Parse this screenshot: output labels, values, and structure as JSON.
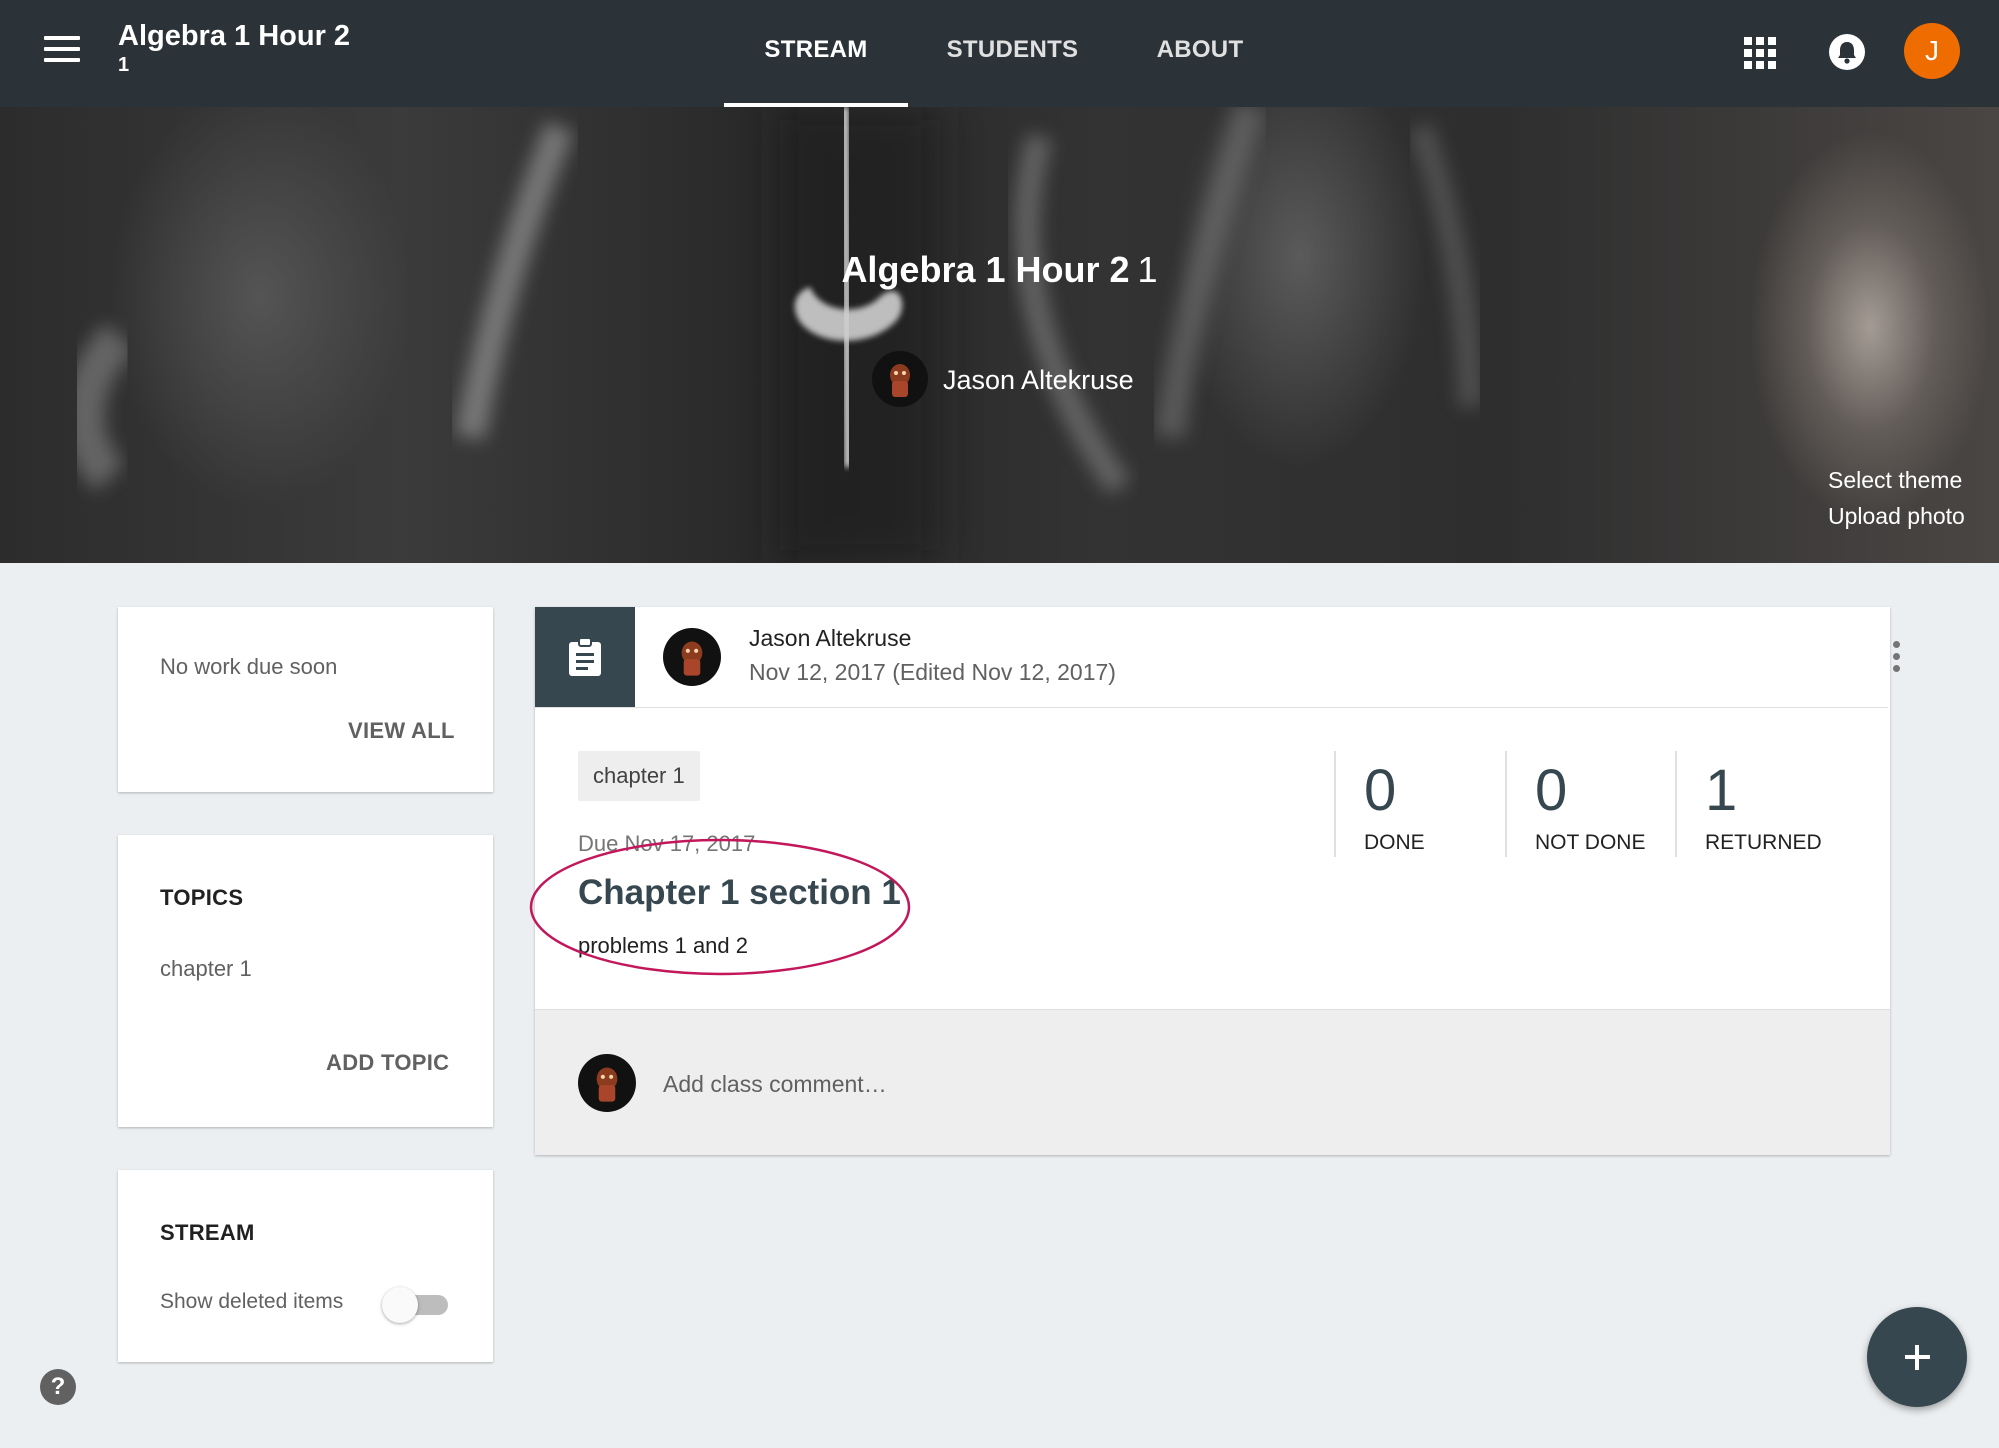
{
  "header": {
    "class_title": "Algebra 1 Hour 2",
    "class_section": "1",
    "tabs": [
      {
        "label": "STREAM",
        "active": true
      },
      {
        "label": "STUDENTS",
        "active": false
      },
      {
        "label": "ABOUT",
        "active": false
      }
    ],
    "user_initial": "J",
    "accent_color": "#ef6c00"
  },
  "banner": {
    "title": "Algebra 1 Hour 2",
    "section": "1",
    "teacher_name": "Jason Altekruse",
    "select_theme": "Select theme",
    "upload_photo": "Upload photo"
  },
  "upcoming": {
    "text": "No work due soon",
    "view_all": "VIEW ALL"
  },
  "topics": {
    "heading": "TOPICS",
    "items": [
      "chapter 1"
    ],
    "add_topic": "ADD TOPIC"
  },
  "stream_settings": {
    "heading": "STREAM",
    "show_deleted_label": "Show deleted items",
    "show_deleted_on": false
  },
  "post": {
    "author": "Jason Altekruse",
    "date": "Nov 12, 2017 (Edited Nov 12, 2017)",
    "topic": "chapter 1",
    "due": "Due Nov 17, 2017",
    "title": "Chapter 1 section 1",
    "description": "problems 1 and 2",
    "stats": [
      {
        "value": "0",
        "label": "DONE"
      },
      {
        "value": "0",
        "label": "NOT DONE"
      },
      {
        "value": "1",
        "label": "RETURNED"
      }
    ],
    "comment_placeholder": "Add class comment…",
    "icon": "assignment-icon",
    "highlight_color": "#c2185b"
  },
  "help": {
    "glyph": "?"
  }
}
